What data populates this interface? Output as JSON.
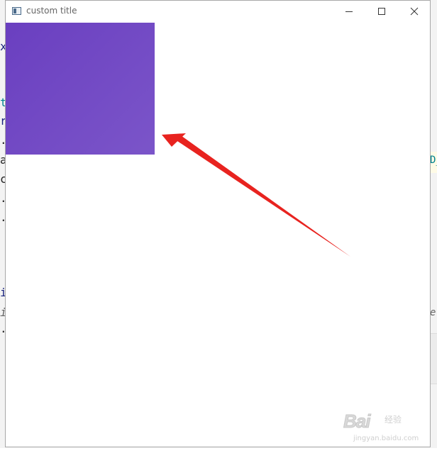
{
  "window": {
    "title": "custom title"
  },
  "caption_buttons": {
    "minimize_icon": "minimize-icon",
    "maximize_icon": "maximize-icon",
    "close_icon": "close-icon"
  },
  "background_code": {
    "fragments": [
      "x",
      "t",
      "r",
      ".",
      "a",
      "c",
      ".",
      ".",
      "i",
      "i",
      "."
    ],
    "right_fragments": [
      "D_",
      "e"
    ]
  },
  "widget": {
    "fill_color_start": "#6a3fc0",
    "fill_color_end": "#7b55c9"
  },
  "annotation": {
    "arrow_color": "#e8231f"
  },
  "watermark": {
    "logo_text": "Bai",
    "logo_suffix": "经验",
    "url": "jingyan.baidu.com"
  }
}
